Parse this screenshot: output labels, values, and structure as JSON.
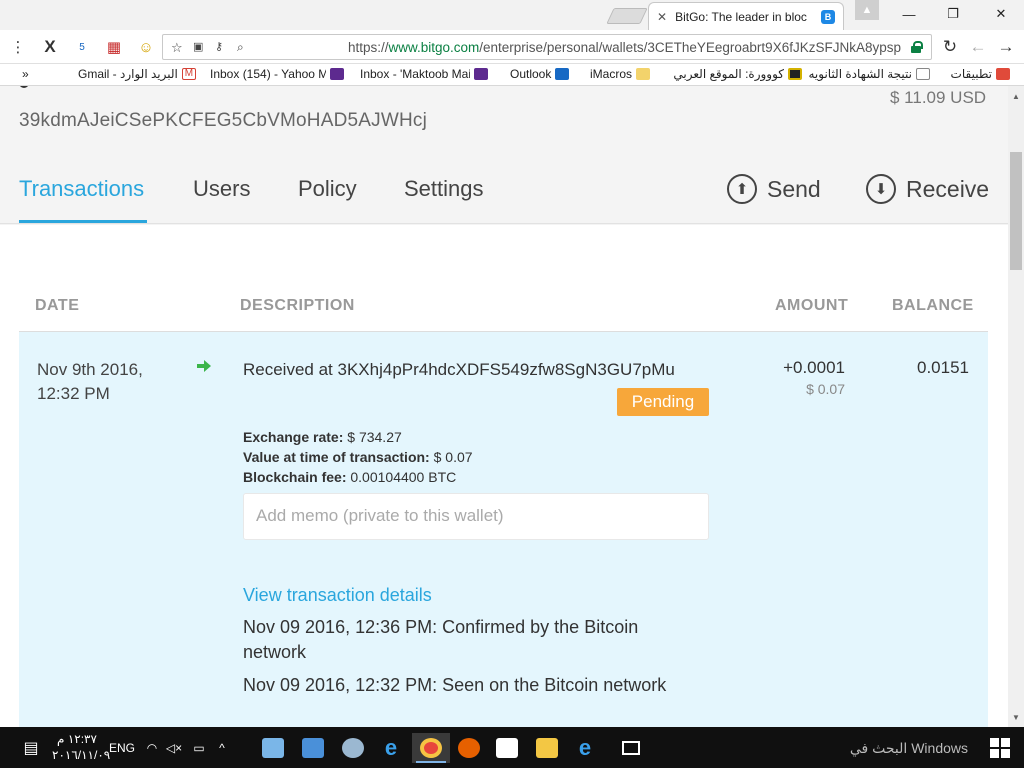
{
  "browser": {
    "tab_title": "BitGo: The leader in bloc",
    "tab_favicon": "B",
    "url_scheme": "https://",
    "url_host": "www.bitgo.com",
    "url_path": "/enterprise/personal/wallets/3CETheYEegroabrt9X6fJKzSFJNkA8ypsp",
    "window": {
      "minimize": "—",
      "restore": "❐",
      "close": "✕"
    },
    "toolbar_icons": {
      "menu": "⋮",
      "ext_x": "X",
      "ext_5": "5",
      "flag": "▦",
      "ext_face": "☺",
      "star": "☆",
      "reload": "↻",
      "back": "←",
      "forward": "→"
    }
  },
  "bookmarks": [
    {
      "label": "تطبيقات",
      "icon_color": "#e04a3a"
    },
    {
      "label": "نتيجة الشهادة الثانويه",
      "icon_color": "#dddddd"
    },
    {
      "label": "كووورة: الموقع العربي",
      "icon_color": "#d4b200"
    },
    {
      "label": "iMacros",
      "icon_color": "#f3d36b"
    },
    {
      "label": "Outlook",
      "icon_color": "#1769c4"
    },
    {
      "label": "Inbox - 'Maktoob Mai",
      "icon_color": "#5d2a8f"
    },
    {
      "label": "Inbox (154) - Yahoo M",
      "icon_color": "#5d2a8f"
    },
    {
      "label": "Gmail - البريد الوارد",
      "icon_color": "#d54135"
    }
  ],
  "bookmarks_more": "»",
  "wallet": {
    "address": "39kdmAJeiCSePKCFEG5CbVMoHAD5AJWHcj",
    "usd_balance": "$ 11.09 USD"
  },
  "nav": {
    "tabs": [
      "Transactions",
      "Users",
      "Policy",
      "Settings"
    ],
    "send_label": "Send",
    "receive_label": "Receive"
  },
  "table": {
    "headers": {
      "date": "DATE",
      "description": "DESCRIPTION",
      "amount": "AMOUNT",
      "balance": "BALANCE"
    },
    "row": {
      "date_line1": "Nov 9th 2016,",
      "date_line2": "12:32 PM",
      "description": "Received at 3KXhj4pPr4hdcXDFS549zfw8SgN3GU7pMu",
      "status": "Pending",
      "exchange_label": "Exchange rate:",
      "exchange_value": "$ 734.27",
      "value_label": "Value at time of transaction:",
      "value_value": "$ 0.07",
      "fee_label": "Blockchain fee:",
      "fee_value": "0.00104400 BTC",
      "memo_placeholder": "Add memo (private to this wallet)",
      "details_link": "View transaction details",
      "history_confirmed": "Nov 09 2016, 12:36 PM: Confirmed by the Bitcoin network",
      "history_seen": "Nov 09 2016, 12:32 PM: Seen on the Bitcoin network",
      "amount": "+0.0001",
      "amount_usd": "$ 0.07",
      "balance": "0.0151"
    }
  },
  "taskbar": {
    "search_placeholder": "البحث في Windows",
    "time": "١٢:٣٧ م",
    "date": "٢٠١٦/١١/٠٩",
    "lang": "ENG"
  }
}
